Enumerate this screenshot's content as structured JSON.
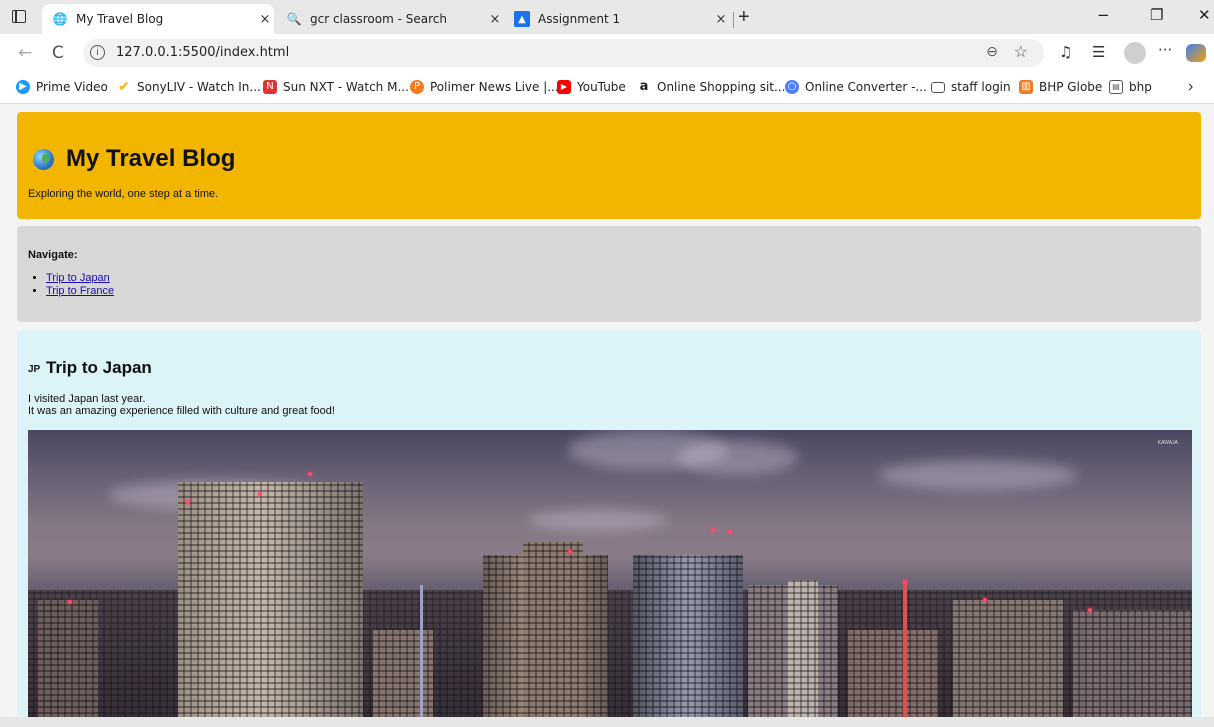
{
  "browser": {
    "tabs": [
      {
        "title": "My Travel Blog",
        "active": true,
        "icon": "globe-icon"
      },
      {
        "title": "gcr classroom - Search",
        "active": false,
        "icon": "search-icon"
      },
      {
        "title": "Assignment 1",
        "active": false,
        "icon": "classroom-icon"
      }
    ],
    "close_glyph": "×",
    "new_tab_glyph": "+",
    "window_controls": {
      "minimize": "−",
      "restore": "❐",
      "close": "✕"
    },
    "nav": {
      "back": "←",
      "reload": "C"
    },
    "url": "127.0.0.1:5500/index.html",
    "toolbar_icons": [
      "zoom-icon",
      "favorite-star-icon",
      "read-aloud-icon",
      "favorites-icon",
      "profile-icon",
      "more-icon",
      "copilot-icon"
    ],
    "more_glyph": "···",
    "bookmarks": [
      {
        "label": "Prime Video",
        "icon": "prime-video-icon",
        "color": "#1a98ff"
      },
      {
        "label": "SonyLIV - Watch In...",
        "icon": "sonyliv-icon",
        "color": "#f5b800"
      },
      {
        "label": "Sun NXT - Watch M...",
        "icon": "sun-nxt-icon",
        "color": "#d33"
      },
      {
        "label": "Polimer News Live |...",
        "icon": "polimer-icon",
        "color": "#f47b20"
      },
      {
        "label": "YouTube",
        "icon": "youtube-icon",
        "color": "#ff0000"
      },
      {
        "label": "Online Shopping sit...",
        "icon": "amazon-icon",
        "color": "#222"
      },
      {
        "label": "Online Converter -...",
        "icon": "converter-icon",
        "color": "#4a7dff"
      },
      {
        "label": "staff login",
        "icon": "folder-icon",
        "color": "#555"
      },
      {
        "label": "BHP Globe",
        "icon": "bhp-globe-icon",
        "color": "#f47b20"
      },
      {
        "label": "bhp",
        "icon": "calendar-icon",
        "color": "#555"
      }
    ],
    "bookmarks_more": "›"
  },
  "page": {
    "header": {
      "title": "My Travel Blog",
      "tagline": "Exploring the world, one step at a time.",
      "bg_color": "#f3b600"
    },
    "nav": {
      "heading": "Navigate:",
      "links": [
        "Trip to Japan",
        "Trip to France"
      ]
    },
    "japan": {
      "flag": "JP",
      "title": "Trip to Japan",
      "line1": "I visited Japan last year.",
      "line2": "It was an amazing experience filled with culture and great food!",
      "photo_watermark": "KAWAJA"
    }
  }
}
